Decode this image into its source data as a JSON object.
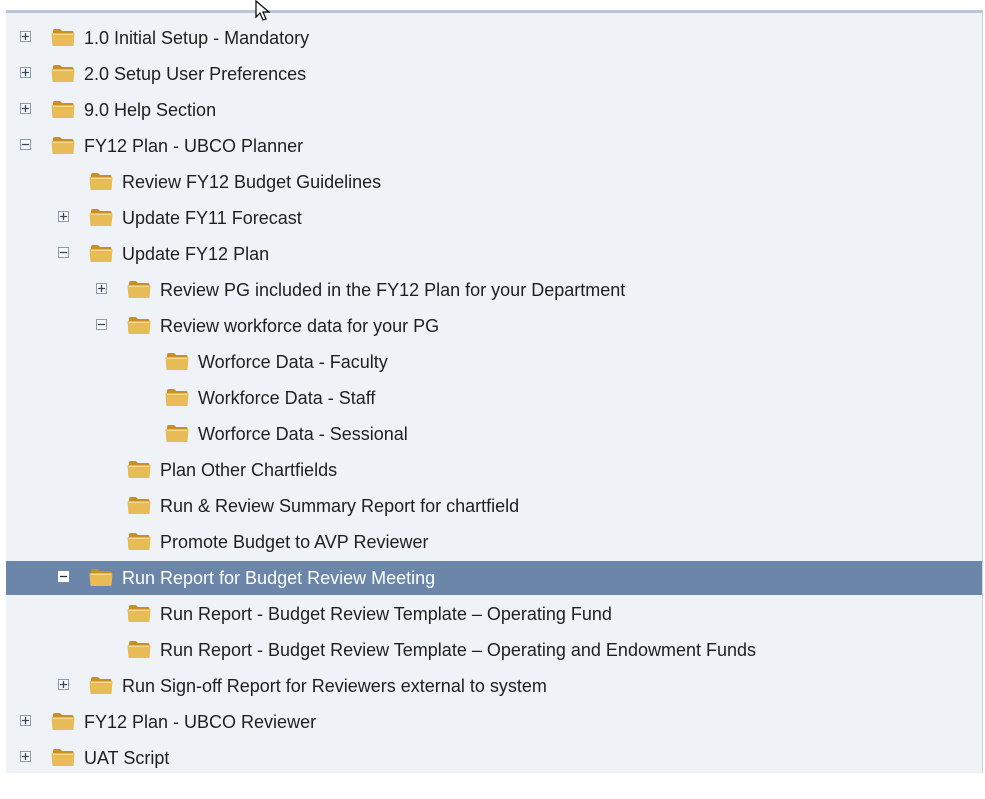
{
  "tree": {
    "items": [
      {
        "label": "1.0 Initial Setup - Mandatory",
        "level": 0,
        "toggle": "expand"
      },
      {
        "label": "2.0 Setup User Preferences",
        "level": 0,
        "toggle": "expand"
      },
      {
        "label": "9.0 Help Section",
        "level": 0,
        "toggle": "expand"
      },
      {
        "label": "FY12 Plan - UBCO Planner",
        "level": 0,
        "toggle": "collapse"
      },
      {
        "label": "Review FY12 Budget Guidelines",
        "level": 1,
        "toggle": "none"
      },
      {
        "label": "Update FY11 Forecast",
        "level": 1,
        "toggle": "expand"
      },
      {
        "label": "Update FY12 Plan",
        "level": 1,
        "toggle": "collapse"
      },
      {
        "label": "Review PG included in the FY12 Plan for your Department",
        "level": 2,
        "toggle": "expand"
      },
      {
        "label": "Review workforce data for your PG",
        "level": 2,
        "toggle": "collapse"
      },
      {
        "label": "Worforce Data - Faculty",
        "level": 3,
        "toggle": "none"
      },
      {
        "label": "Workforce Data - Staff",
        "level": 3,
        "toggle": "none"
      },
      {
        "label": "Worforce Data - Sessional",
        "level": 3,
        "toggle": "none"
      },
      {
        "label": "Plan Other Chartfields",
        "level": 2,
        "toggle": "none"
      },
      {
        "label": "Run & Review Summary Report for chartfield",
        "level": 2,
        "toggle": "none"
      },
      {
        "label": "Promote Budget to AVP Reviewer",
        "level": 2,
        "toggle": "none"
      },
      {
        "label": "Run Report for Budget Review Meeting",
        "level": 1,
        "toggle": "collapse",
        "selected": true
      },
      {
        "label": "Run Report - Budget Review Template – Operating Fund",
        "level": 2,
        "toggle": "none"
      },
      {
        "label": "Run Report - Budget Review Template – Operating and Endowment Funds",
        "level": 2,
        "toggle": "none"
      },
      {
        "label": "Run Sign-off Report for Reviewers external to system",
        "level": 1,
        "toggle": "expand"
      },
      {
        "label": "FY12 Plan - UBCO Reviewer",
        "level": 0,
        "toggle": "expand"
      },
      {
        "label": "UAT Script",
        "level": 0,
        "toggle": "expand"
      }
    ]
  },
  "icons": {
    "folder": "folder-icon",
    "expand": "expand-icon",
    "collapse": "collapse-icon",
    "cursor": "mouse-cursor-icon"
  },
  "colors": {
    "panel_background": "#eff3f7",
    "selected_row": "#6b86a9",
    "folder": "#d8a83a"
  }
}
